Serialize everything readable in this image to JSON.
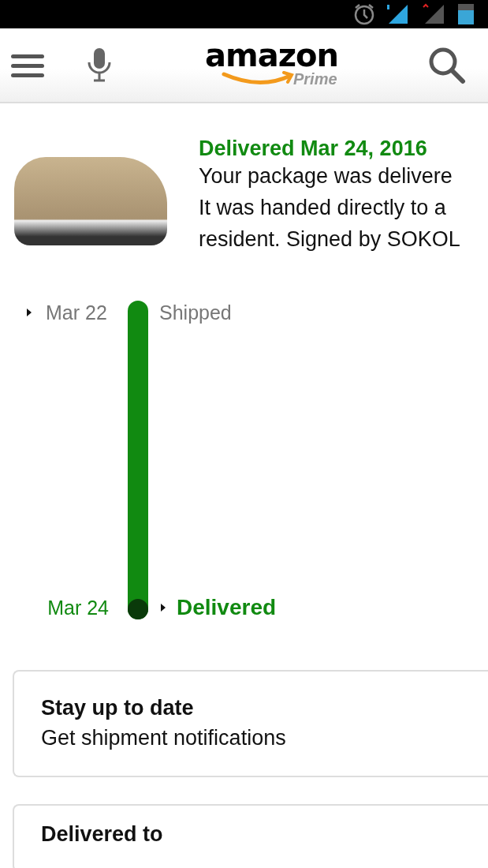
{
  "header": {
    "logo": "amazon",
    "logo_sub": "Prime"
  },
  "shipment": {
    "title": "Delivered Mar 24, 2016",
    "message_lines": [
      "Your package was delivere",
      "It was handed directly to a",
      "resident. Signed by SOKOL"
    ]
  },
  "timeline": [
    {
      "date": "Mar 22",
      "status": "Shipped",
      "current": false
    },
    {
      "date": "Mar 24",
      "status": "Delivered",
      "current": true
    }
  ],
  "cards": [
    {
      "title": "Stay up to date",
      "subtitle": "Get shipment notifications"
    },
    {
      "title": "Delivered to"
    }
  ]
}
